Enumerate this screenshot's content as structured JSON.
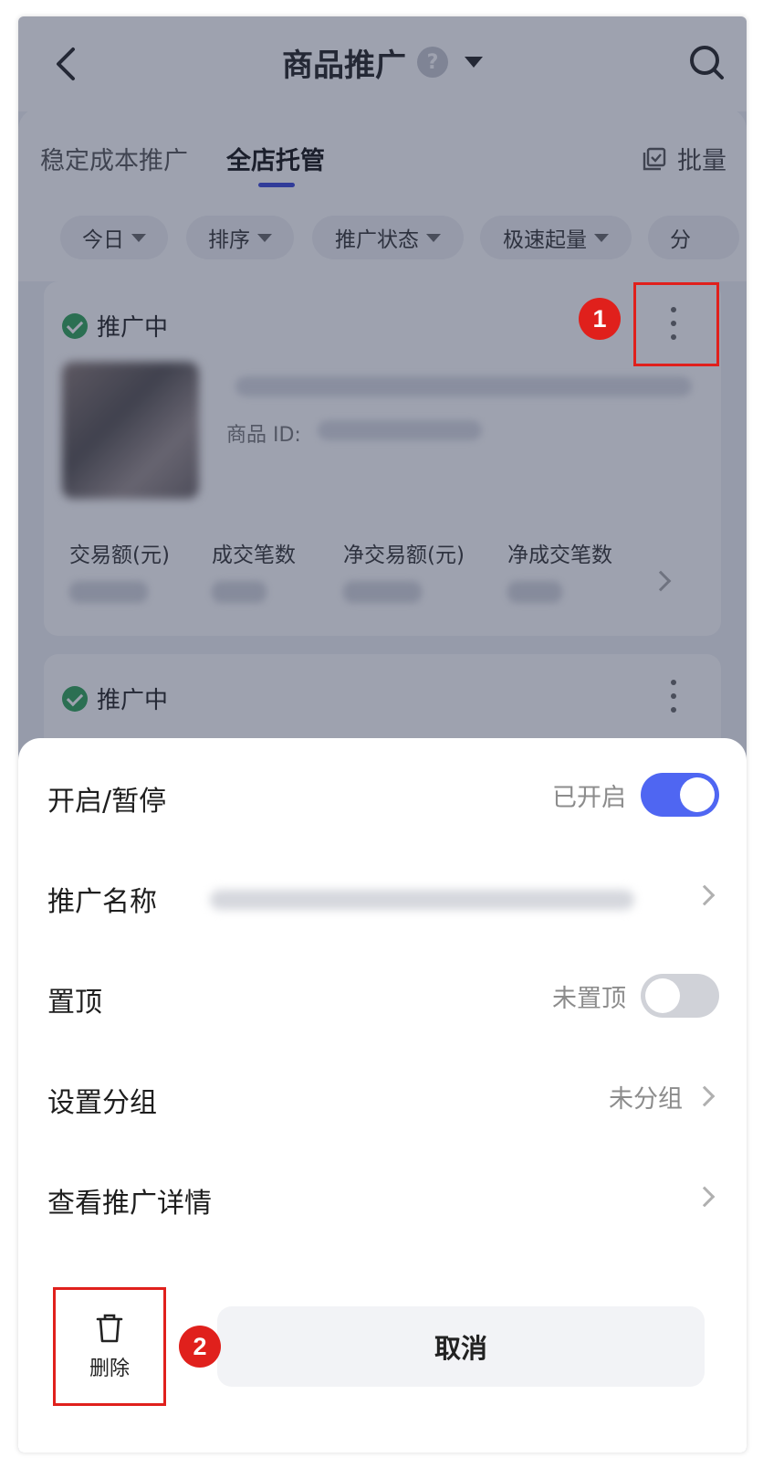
{
  "header": {
    "title": "商品推广",
    "help_glyph": "?"
  },
  "tabs": [
    {
      "label": "稳定成本推广"
    },
    {
      "label": "全店托管"
    }
  ],
  "batch_label": "批量",
  "filters": [
    "今日",
    "排序",
    "推广状态",
    "极速起量",
    "分"
  ],
  "cards": [
    {
      "status": "推广中",
      "product_id_label": "商品 ID:",
      "metrics": [
        "交易额(元)",
        "成交笔数",
        "净交易额(元)",
        "净成交笔数"
      ]
    },
    {
      "status": "推广中"
    }
  ],
  "sheet": {
    "rows": [
      {
        "label": "开启/暂停",
        "value": "已开启",
        "toggle_on": true
      },
      {
        "label": "推广名称"
      },
      {
        "label": "置顶",
        "value": "未置顶",
        "toggle_on": false
      },
      {
        "label": "设置分组",
        "value": "未分组"
      },
      {
        "label": "查看推广详情"
      }
    ],
    "delete_label": "删除",
    "cancel_label": "取消"
  },
  "annotations": [
    {
      "label": "1"
    },
    {
      "label": "2"
    }
  ],
  "colors": {
    "accent": "#4f66f2",
    "success": "#2ea356",
    "annotation": "#e0201c"
  }
}
